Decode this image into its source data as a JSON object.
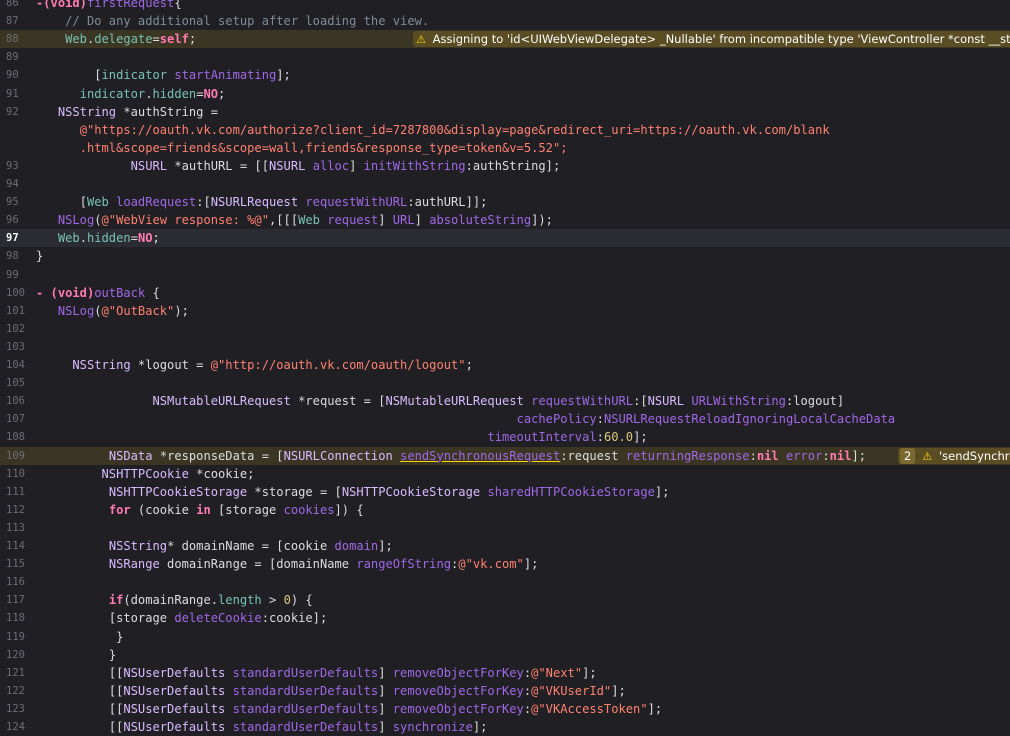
{
  "editor": {
    "lines": [
      {
        "n": "86",
        "indent": "",
        "tokens": [
          [
            "kw",
            "-(void)"
          ],
          [
            "fn",
            "firstRequest"
          ],
          [
            "pl",
            "{"
          ]
        ]
      },
      {
        "n": "87",
        "indent": "    ",
        "tokens": [
          [
            "cm",
            "// Do any additional setup after loading the view."
          ]
        ]
      },
      {
        "n": "88",
        "indent": "    ",
        "hl": "warn",
        "tokens": [
          [
            "var",
            "Web"
          ],
          [
            "pl",
            "."
          ],
          [
            "var",
            "delegate"
          ],
          [
            "pl",
            "="
          ],
          [
            "kw",
            "self"
          ],
          [
            "pl",
            ";"
          ]
        ]
      },
      {
        "n": "89",
        "indent": "",
        "tokens": []
      },
      {
        "n": "90",
        "indent": "        ",
        "tokens": [
          [
            "pl",
            "["
          ],
          [
            "var",
            "indicator"
          ],
          [
            "pl",
            " "
          ],
          [
            "fn",
            "startAnimating"
          ],
          [
            "pl",
            "];"
          ]
        ]
      },
      {
        "n": "91",
        "indent": "      ",
        "tokens": [
          [
            "var",
            "indicator"
          ],
          [
            "pl",
            "."
          ],
          [
            "var",
            "hidden"
          ],
          [
            "pl",
            "="
          ],
          [
            "kw",
            "NO"
          ],
          [
            "pl",
            ";"
          ]
        ]
      },
      {
        "n": "92",
        "indent": "   ",
        "tokens": [
          [
            "ty",
            "NSString"
          ],
          [
            "pl",
            " *authString ="
          ]
        ]
      },
      {
        "n": "",
        "indent": "      ",
        "tokens": [
          [
            "str",
            "@\"https://oauth.vk.com/authorize?client_id=7287800&display=page&redirect_uri=https://oauth.vk.com/blank"
          ]
        ]
      },
      {
        "n": "",
        "indent": "      ",
        "tokens": [
          [
            "str",
            ".html&scope=friends&scope=wall,friends&response_type=token&v=5.52\";"
          ]
        ]
      },
      {
        "n": "93",
        "indent": "             ",
        "tokens": [
          [
            "ty",
            "NSURL"
          ],
          [
            "pl",
            " *authURL = [["
          ],
          [
            "ty",
            "NSURL"
          ],
          [
            "pl",
            " "
          ],
          [
            "fn",
            "alloc"
          ],
          [
            "pl",
            "] "
          ],
          [
            "fn",
            "initWithString"
          ],
          [
            "pl",
            ":authString];"
          ]
        ]
      },
      {
        "n": "94",
        "indent": "",
        "tokens": []
      },
      {
        "n": "95",
        "indent": "      ",
        "tokens": [
          [
            "pl",
            "["
          ],
          [
            "var",
            "Web"
          ],
          [
            "pl",
            " "
          ],
          [
            "fn",
            "loadRequest"
          ],
          [
            "pl",
            ":["
          ],
          [
            "ty",
            "NSURLRequest"
          ],
          [
            "pl",
            " "
          ],
          [
            "fn",
            "requestWithURL"
          ],
          [
            "pl",
            ":authURL]];"
          ]
        ]
      },
      {
        "n": "96",
        "indent": "   ",
        "tokens": [
          [
            "fn",
            "NSLog"
          ],
          [
            "pl",
            "("
          ],
          [
            "str",
            "@\"WebView response: %@\""
          ],
          [
            "pl",
            ",[[["
          ],
          [
            "var",
            "Web"
          ],
          [
            "pl",
            " "
          ],
          [
            "fn",
            "request"
          ],
          [
            "pl",
            "] "
          ],
          [
            "fn",
            "URL"
          ],
          [
            "pl",
            "] "
          ],
          [
            "fn",
            "absoluteString"
          ],
          [
            "pl",
            "]);"
          ]
        ]
      },
      {
        "n": "97",
        "indent": "   ",
        "hl": "current",
        "tokens": [
          [
            "var",
            "Web"
          ],
          [
            "pl",
            "."
          ],
          [
            "var",
            "hidden"
          ],
          [
            "pl",
            "="
          ],
          [
            "kw",
            "NO"
          ],
          [
            "pl",
            ";"
          ]
        ]
      },
      {
        "n": "98",
        "indent": "",
        "tokens": [
          [
            "pl",
            "}"
          ]
        ]
      },
      {
        "n": "99",
        "indent": "",
        "tokens": []
      },
      {
        "n": "100",
        "indent": "",
        "tokens": [
          [
            "kw",
            "- (void)"
          ],
          [
            "fn",
            "outBack"
          ],
          [
            "pl",
            " {"
          ]
        ]
      },
      {
        "n": "101",
        "indent": "   ",
        "tokens": [
          [
            "fn",
            "NSLog"
          ],
          [
            "pl",
            "("
          ],
          [
            "str",
            "@\"OutBack\""
          ],
          [
            "pl",
            ");"
          ]
        ]
      },
      {
        "n": "102",
        "indent": "",
        "tokens": []
      },
      {
        "n": "103",
        "indent": "",
        "tokens": []
      },
      {
        "n": "104",
        "indent": "     ",
        "tokens": [
          [
            "ty",
            "NSString"
          ],
          [
            "pl",
            " *logout = "
          ],
          [
            "str",
            "@\"http://oauth.vk.com/oauth/logout\""
          ],
          [
            "pl",
            ";"
          ]
        ]
      },
      {
        "n": "105",
        "indent": "",
        "tokens": []
      },
      {
        "n": "106",
        "indent": "                ",
        "tokens": [
          [
            "ty",
            "NSMutableURLRequest"
          ],
          [
            "pl",
            " *request = ["
          ],
          [
            "ty",
            "NSMutableURLRequest"
          ],
          [
            "pl",
            " "
          ],
          [
            "fn",
            "requestWithURL"
          ],
          [
            "pl",
            ":["
          ],
          [
            "ty",
            "NSURL"
          ],
          [
            "pl",
            " "
          ],
          [
            "fn",
            "URLWithString"
          ],
          [
            "pl",
            ":logout]"
          ]
        ]
      },
      {
        "n": "107",
        "indent": "                                                                  ",
        "tokens": [
          [
            "fn",
            "cachePolicy"
          ],
          [
            "pl",
            ":"
          ],
          [
            "fn",
            "NSURLRequestReloadIgnoringLocalCacheData"
          ]
        ]
      },
      {
        "n": "108",
        "indent": "                                                              ",
        "tokens": [
          [
            "fn",
            "timeoutInterval"
          ],
          [
            "pl",
            ":"
          ],
          [
            "num",
            "60.0"
          ],
          [
            "pl",
            "];"
          ]
        ]
      },
      {
        "n": "109",
        "indent": "          ",
        "hl": "warn",
        "tokens": [
          [
            "ty",
            "NSData"
          ],
          [
            "pl",
            " *"
          ],
          [
            "pl",
            "responseData = ["
          ],
          [
            "ty",
            "NSURLConnection"
          ],
          [
            "pl",
            " "
          ],
          [
            "fnu",
            "sendSynchronousRequest"
          ],
          [
            "pl",
            ":request "
          ],
          [
            "fn",
            "returningResponse"
          ],
          [
            "pl",
            ":"
          ],
          [
            "kw",
            "nil"
          ],
          [
            "pl",
            " "
          ],
          [
            "fn",
            "error"
          ],
          [
            "pl",
            ":"
          ],
          [
            "kw",
            "nil"
          ],
          [
            "pl",
            "];"
          ]
        ]
      },
      {
        "n": "110",
        "indent": "         ",
        "tokens": [
          [
            "ty",
            "NSHTTPCookie"
          ],
          [
            "pl",
            " *cookie;"
          ]
        ]
      },
      {
        "n": "111",
        "indent": "          ",
        "tokens": [
          [
            "ty",
            "NSHTTPCookieStorage"
          ],
          [
            "pl",
            " *storage = ["
          ],
          [
            "ty",
            "NSHTTPCookieStorage"
          ],
          [
            "pl",
            " "
          ],
          [
            "fn",
            "sharedHTTPCookieStorage"
          ],
          [
            "pl",
            "];"
          ]
        ]
      },
      {
        "n": "112",
        "indent": "          ",
        "tokens": [
          [
            "kw",
            "for"
          ],
          [
            "pl",
            " (cookie "
          ],
          [
            "kw",
            "in"
          ],
          [
            "pl",
            " [storage "
          ],
          [
            "fn",
            "cookies"
          ],
          [
            "pl",
            "]) {"
          ]
        ]
      },
      {
        "n": "113",
        "indent": "",
        "tokens": []
      },
      {
        "n": "114",
        "indent": "          ",
        "tokens": [
          [
            "ty",
            "NSString"
          ],
          [
            "pl",
            "* domainName = [cookie "
          ],
          [
            "fn",
            "domain"
          ],
          [
            "pl",
            "];"
          ]
        ]
      },
      {
        "n": "115",
        "indent": "          ",
        "tokens": [
          [
            "ty",
            "NSRange"
          ],
          [
            "pl",
            " domainRange = [domainName "
          ],
          [
            "fn",
            "rangeOfString"
          ],
          [
            "pl",
            ":"
          ],
          [
            "str",
            "@\"vk.com\""
          ],
          [
            "pl",
            "];"
          ]
        ]
      },
      {
        "n": "116",
        "indent": "",
        "tokens": []
      },
      {
        "n": "117",
        "indent": "          ",
        "tokens": [
          [
            "kw",
            "if"
          ],
          [
            "pl",
            "(domainRange."
          ],
          [
            "var",
            "length"
          ],
          [
            "pl",
            " > "
          ],
          [
            "num",
            "0"
          ],
          [
            "pl",
            ") {"
          ]
        ]
      },
      {
        "n": "118",
        "indent": "          ",
        "tokens": [
          [
            "pl",
            "[storage "
          ],
          [
            "fn",
            "deleteCookie"
          ],
          [
            "pl",
            ":cookie];"
          ]
        ]
      },
      {
        "n": "119",
        "indent": "           ",
        "tokens": [
          [
            "pl",
            "}"
          ]
        ]
      },
      {
        "n": "120",
        "indent": "          ",
        "tokens": [
          [
            "pl",
            "}"
          ]
        ]
      },
      {
        "n": "121",
        "indent": "          ",
        "tokens": [
          [
            "pl",
            "[["
          ],
          [
            "ty",
            "NSUserDefaults"
          ],
          [
            "pl",
            " "
          ],
          [
            "fn",
            "standardUserDefaults"
          ],
          [
            "pl",
            "] "
          ],
          [
            "fn",
            "removeObjectForKey"
          ],
          [
            "pl",
            ":"
          ],
          [
            "str",
            "@\"Next\""
          ],
          [
            "pl",
            "];"
          ]
        ]
      },
      {
        "n": "122",
        "indent": "          ",
        "tokens": [
          [
            "pl",
            "[["
          ],
          [
            "ty",
            "NSUserDefaults"
          ],
          [
            "pl",
            " "
          ],
          [
            "fn",
            "standardUserDefaults"
          ],
          [
            "pl",
            "] "
          ],
          [
            "fn",
            "removeObjectForKey"
          ],
          [
            "pl",
            ":"
          ],
          [
            "str",
            "@\"VKUserId\""
          ],
          [
            "pl",
            "];"
          ]
        ]
      },
      {
        "n": "123",
        "indent": "          ",
        "tokens": [
          [
            "pl",
            "[["
          ],
          [
            "ty",
            "NSUserDefaults"
          ],
          [
            "pl",
            " "
          ],
          [
            "fn",
            "standardUserDefaults"
          ],
          [
            "pl",
            "] "
          ],
          [
            "fn",
            "removeObjectForKey"
          ],
          [
            "pl",
            ":"
          ],
          [
            "str",
            "@\"VKAccessToken\""
          ],
          [
            "pl",
            "];"
          ]
        ]
      },
      {
        "n": "124",
        "indent": "          ",
        "tokens": [
          [
            "pl",
            "[["
          ],
          [
            "ty",
            "NSUserDefaults"
          ],
          [
            "pl",
            " "
          ],
          [
            "fn",
            "standardUserDefaults"
          ],
          [
            "pl",
            "] "
          ],
          [
            "fn",
            "synchronize"
          ],
          [
            "pl",
            "];"
          ]
        ]
      }
    ],
    "current_line": "97"
  },
  "issues": [
    {
      "line": "88",
      "icon": "warning-triangle-icon",
      "count": "",
      "text": "Assigning to 'id<UIWebViewDelegate> _Nullable' from incompatible type 'ViewController *const __stro"
    },
    {
      "line": "109",
      "icon": "warning-triangle-icon",
      "count": "2",
      "text": "'sendSynchro"
    }
  ],
  "colors": {
    "background": "#1f1f24",
    "keyword": "#ff7ab2",
    "string": "#ff8170",
    "comment": "#7f8c98",
    "type": "#dabaff",
    "method": "#a167e6",
    "variable": "#78c2b3",
    "number": "#d9c97c",
    "warning_line": "#3b3524",
    "warning_badge": "#5a4d24",
    "warning_icon": "#ffd60a"
  }
}
